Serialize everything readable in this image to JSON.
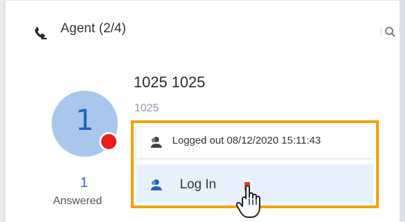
{
  "header": {
    "title": "Agent (2/4)",
    "icon": "phone-icon",
    "search_icon": "search-icon"
  },
  "agent": {
    "name": "1025 1025",
    "extension": "1025",
    "avatar_text": "1",
    "answered_count": "1",
    "answered_label": "Answered"
  },
  "menu": {
    "status_text": "Logged out 08/12/2020 15:11:43",
    "login_label": "Log In"
  },
  "colors": {
    "accent": "#1f61c7",
    "avatar_bg": "#a8c7ea",
    "status_dot": "#ea1c1c",
    "highlight_border": "#f5a10a",
    "login_bg": "#e6f1fb"
  }
}
